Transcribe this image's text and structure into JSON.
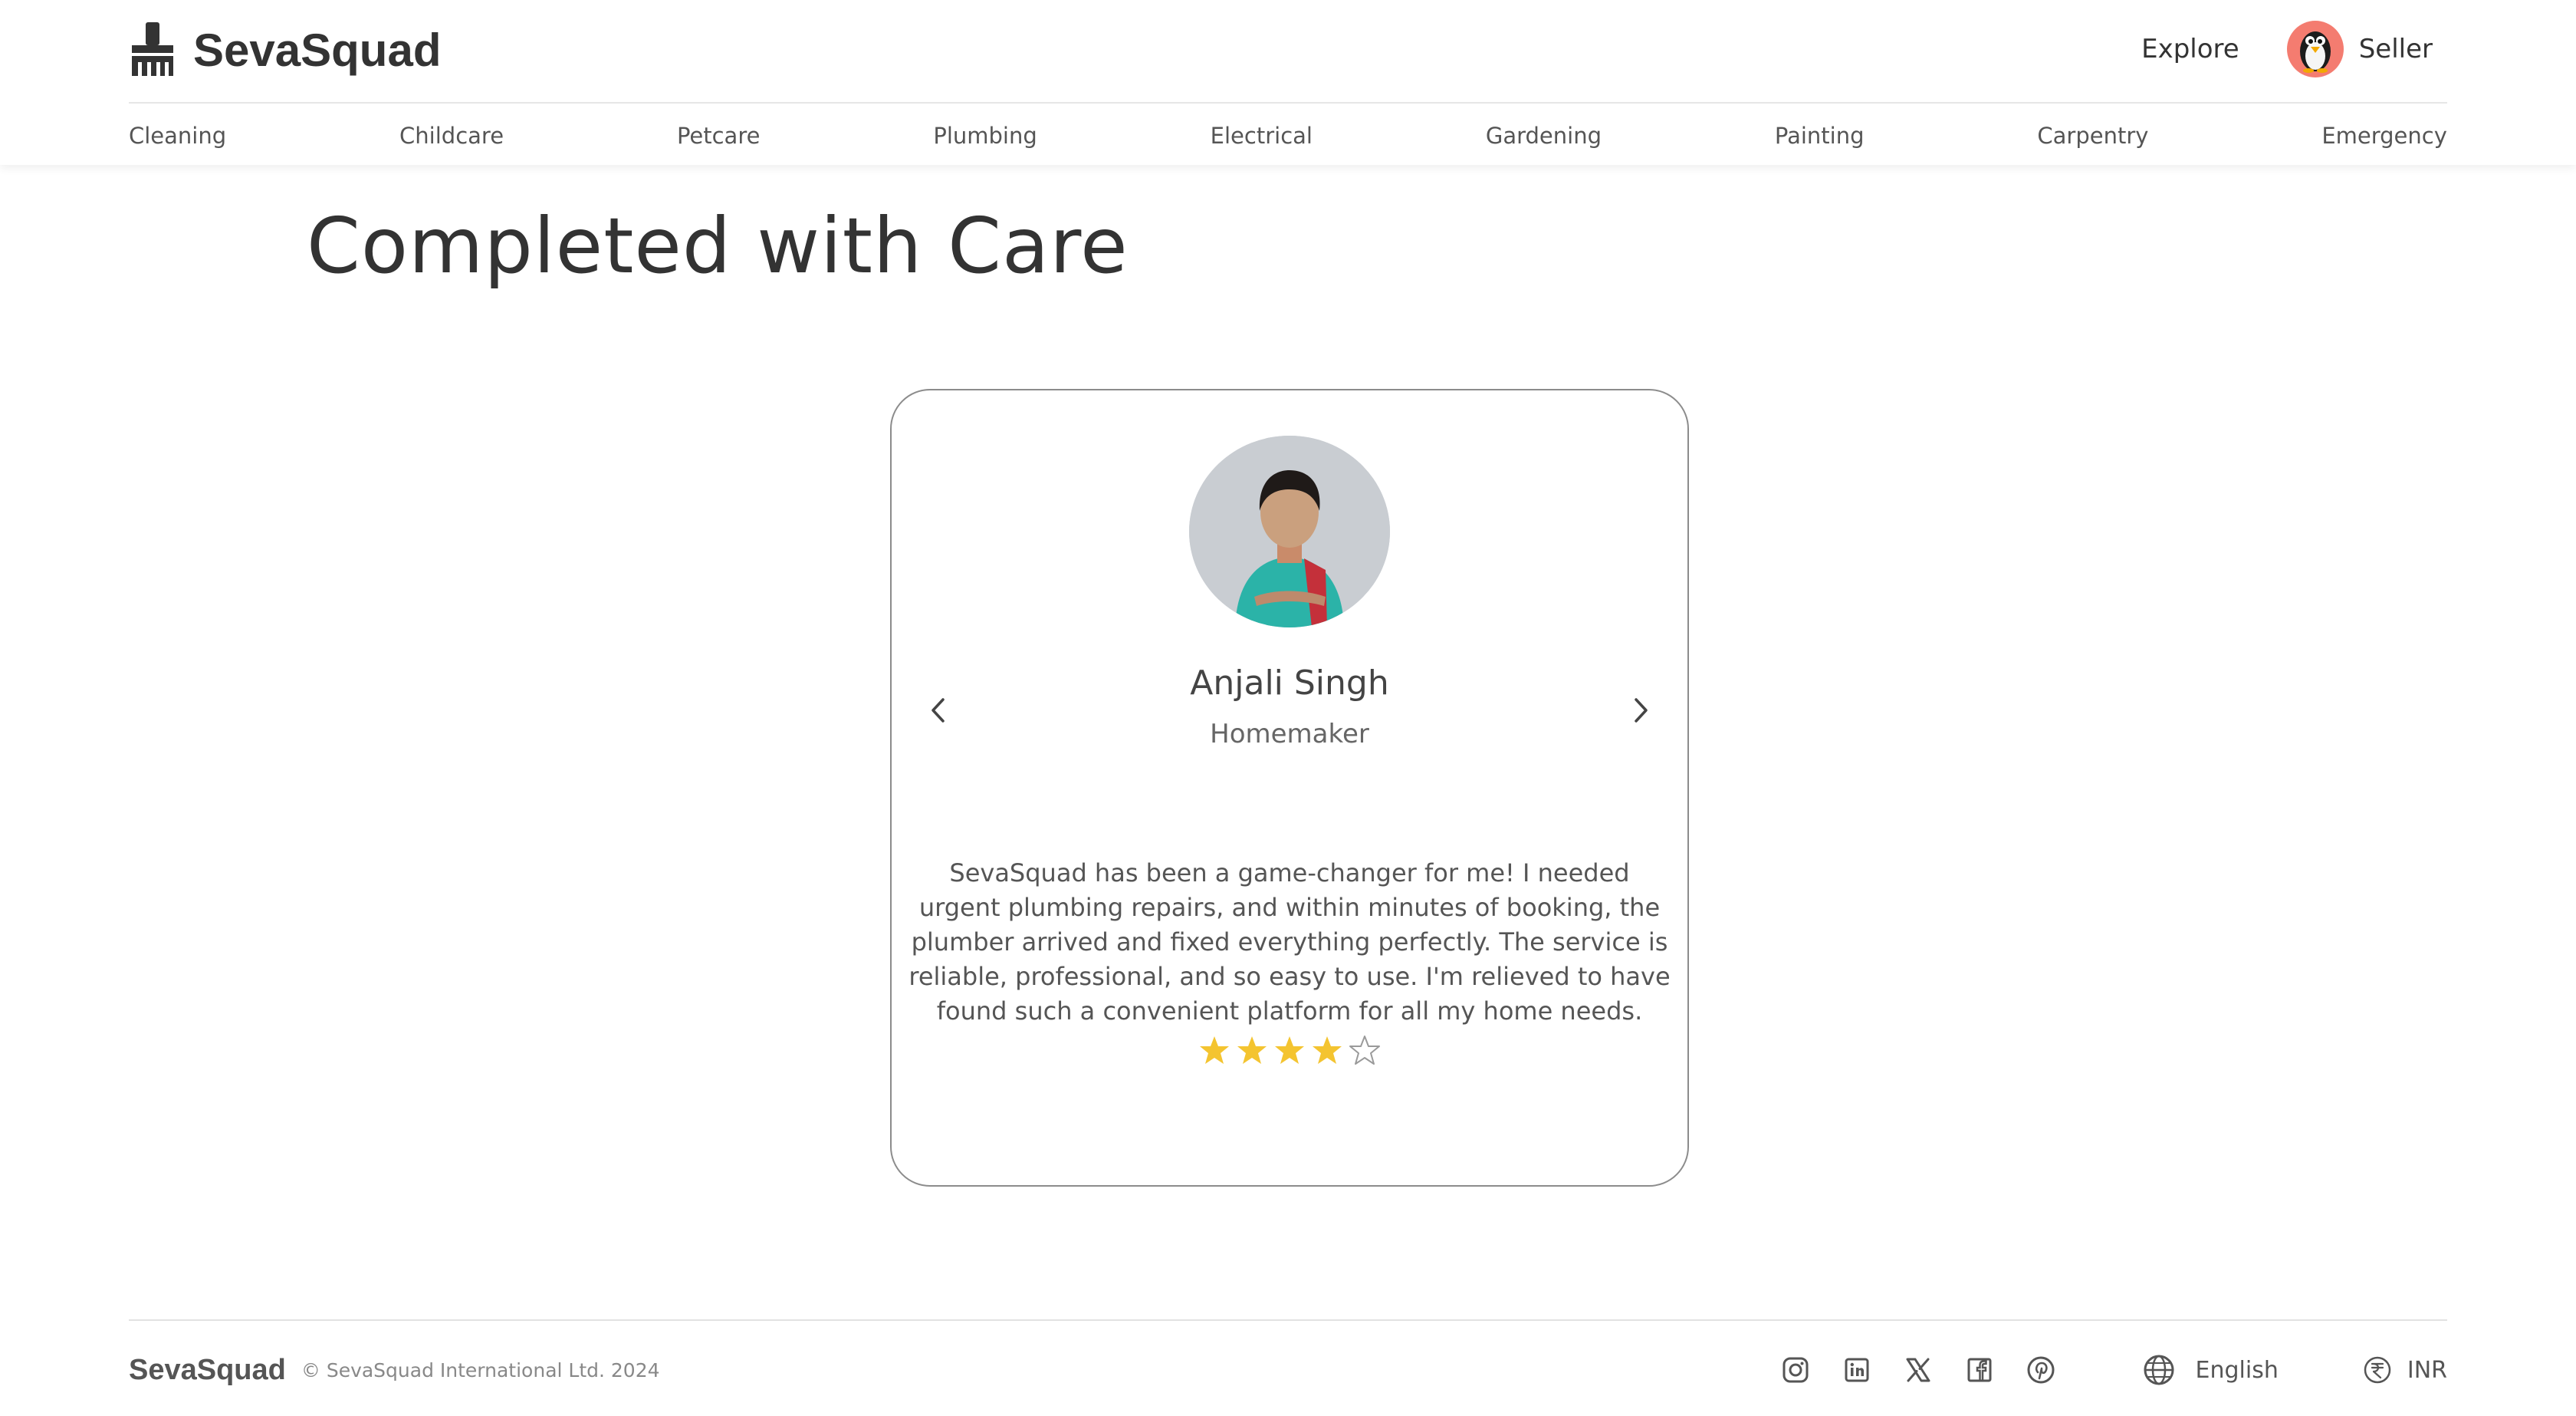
{
  "brand": {
    "name": "SevaSquad",
    "icon": "broom-icon"
  },
  "header": {
    "explore": "Explore",
    "seller": "Seller",
    "avatar_icon": "penguin-icon"
  },
  "categories": [
    "Cleaning",
    "Childcare",
    "Petcare",
    "Plumbing",
    "Electrical",
    "Gardening",
    "Painting",
    "Carpentry",
    "Emergency"
  ],
  "main": {
    "title": "Completed with Care"
  },
  "testimonial": {
    "name": "Anjali Singh",
    "role": "Homemaker",
    "text": "SevaSquad has been a game-changer for me! I needed urgent plumbing repairs, and within minutes of booking, the plumber arrived and fixed everything perfectly. The service is reliable, professional, and so easy to use. I'm relieved to have found such a convenient platform for all my home needs.",
    "rating": 4,
    "max_rating": 5
  },
  "footer": {
    "brand": "SevaSquad",
    "copyright": "© SevaSquad International Ltd. 2024",
    "social": [
      "instagram-icon",
      "linkedin-icon",
      "x-icon",
      "facebook-icon",
      "pinterest-icon"
    ],
    "language": "English",
    "currency": "INR"
  },
  "colors": {
    "star": "#f4c430",
    "star_empty": "#9a9a9a",
    "card_border": "#8c8c8c",
    "avatar_bg": "#f47c70"
  }
}
